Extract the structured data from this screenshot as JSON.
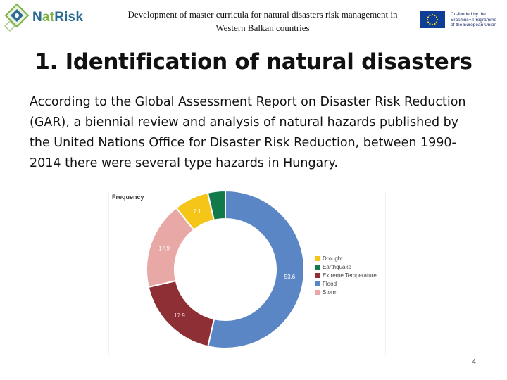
{
  "header": {
    "logo": {
      "prefix": "N",
      "accent": "at",
      "suffix": "Risk"
    },
    "title_line1": "Development of master curricula for natural disasters risk management in",
    "title_line2": "Western Balkan countries",
    "eu_text": [
      "Co-funded by the",
      "Erasmus+ Programme",
      "of the European Union"
    ]
  },
  "slide": {
    "title": "1. Identification of natural disasters",
    "body": "According to the Global Assessment Report on Disaster Risk Reduction (GAR), a biennial review and analysis of natural hazards published by the United Nations Office for Disaster Risk Reduction, between 1990-2014 there were several type hazards in Hungary.",
    "page_number": "4"
  },
  "chart_data": {
    "type": "pie",
    "variant": "donut",
    "title": "Frequency",
    "labels": [
      "Drought",
      "Earthquake",
      "Extreme Temperature",
      "Flood",
      "Storm"
    ],
    "values": [
      7.1,
      3.6,
      17.9,
      53.6,
      17.9
    ],
    "slice_labels": [
      "7.1",
      "",
      "17.9",
      "53.6",
      "17.9"
    ],
    "colors": [
      "#f5c518",
      "#127a4a",
      "#8e2f35",
      "#5b86c5",
      "#e8a9a6"
    ],
    "legend_position": "right"
  }
}
